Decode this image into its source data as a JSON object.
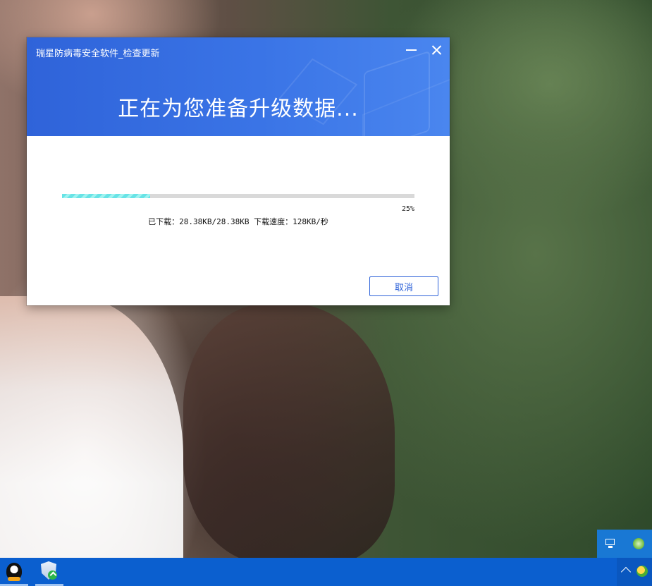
{
  "dialog": {
    "title": "瑞星防病毒安全软件_检查更新",
    "headline": "正在为您准备升级数据...",
    "progress": {
      "percent_label": "25%",
      "value": 0.25
    },
    "download_info": "已下载：28.38KB/28.38KB 下载速度：128KB/秒",
    "cancel_label": "取消"
  },
  "tray_popup": {
    "icons": [
      "network-icon",
      "xbox-icon"
    ]
  },
  "taskbar": {
    "apps": [
      "qq-app-icon",
      "rising-antivirus-update-icon"
    ],
    "tray": [
      "show-hidden-icons-chevron",
      "security-tray-icon"
    ]
  },
  "colors": {
    "header_blue": "#2f63d9",
    "taskbar_blue": "#0b5fcf",
    "progress_cyan": "#68e3e6"
  }
}
